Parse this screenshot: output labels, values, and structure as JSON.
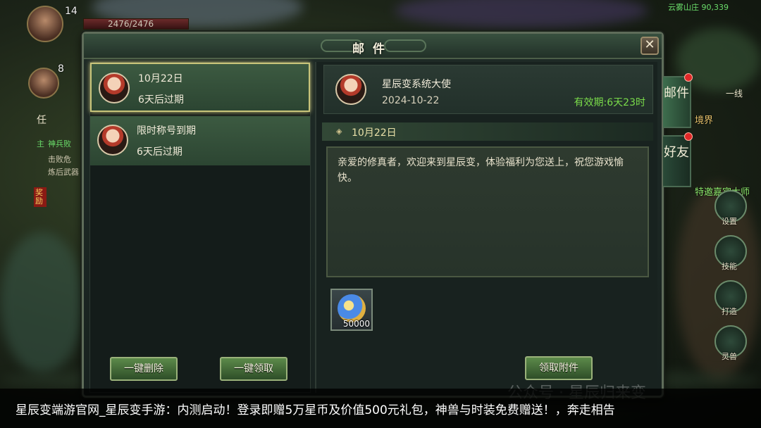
{
  "hud": {
    "hp_text": "2476/2476",
    "level_top": "14",
    "level_second": "8",
    "task_tab": "任",
    "task_main_tag": "主",
    "task_line1": "神兵败",
    "task_line2": "击败危",
    "task_line3": "炼后武器",
    "reward_tag": "奖励",
    "coordinates": "云雾山庄 90,339",
    "line_tag": "一线",
    "right_labels": [
      "设置",
      "技能",
      "打造",
      "灵兽"
    ],
    "place_text": "特邀嘉宾大师",
    "realm_text": "境界"
  },
  "window": {
    "title": "邮件",
    "close": "✕"
  },
  "mail_list": [
    {
      "title": "10月22日",
      "expiry": "6天后过期"
    },
    {
      "title": "限时称号到期",
      "expiry": "6天后过期"
    }
  ],
  "list_buttons": {
    "delete_all": "一键删除",
    "claim_all": "一键领取"
  },
  "detail": {
    "sender": "星辰变系统大使",
    "date": "2024-10-22",
    "validity": "有效期:6天23时",
    "subject": "10月22日",
    "body": "亲爱的修真者，欢迎来到星辰变，体验福利为您送上，祝您游戏愉快。",
    "attachment_qty": "50000",
    "claim_button": "领取附件"
  },
  "side_tabs": [
    {
      "label": "邮件",
      "active": true
    },
    {
      "label": "好友",
      "active": false
    }
  ],
  "caption": "星辰变端游官网_星辰变手游：内测启动！登录即赠5万星币及价值500元礼包，神兽与时装免费赠送！，奔走相告",
  "watermark": "公众号 · 星辰归来变"
}
